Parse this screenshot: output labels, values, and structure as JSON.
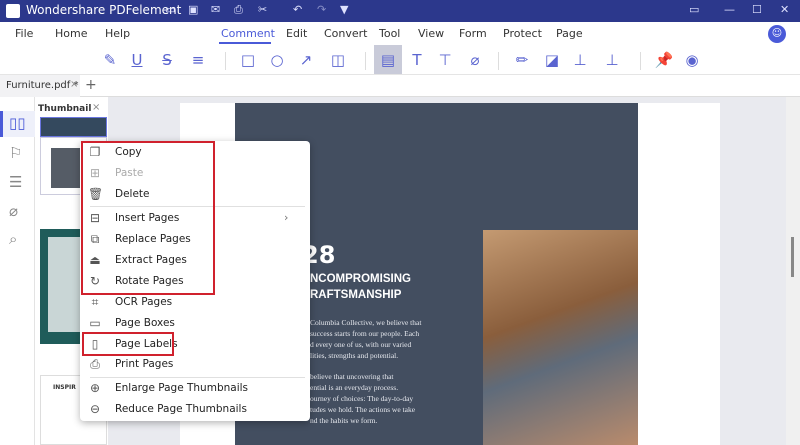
{
  "app": {
    "title": "Wondershare PDFelement",
    "colors": {
      "titlebar": "#2c388c",
      "accent": "#4a5ad8",
      "highlight_box": "#d0212d"
    }
  },
  "titlebar_icons": [
    "open-folder-icon",
    "save-icon",
    "mail-icon",
    "print-icon",
    "scissors-icon",
    "undo-icon",
    "redo-icon",
    "dropdown-arrow-icon"
  ],
  "menu": [
    "File",
    "Home",
    "Help",
    "Comment",
    "Edit",
    "Convert",
    "Tool",
    "View",
    "Form",
    "Protect",
    "Page"
  ],
  "active_menu": "Comment",
  "tab": {
    "label": "Furniture.pdf *",
    "close": "×",
    "add": "+"
  },
  "thumbnail_panel": {
    "title": "Thumbnail",
    "close": "×",
    "thumb_text": "INSPIR"
  },
  "context_menu": [
    {
      "label": "Copy",
      "icon": "copy-icon"
    },
    {
      "label": "Paste",
      "icon": "paste-icon",
      "disabled": true
    },
    {
      "label": "Delete",
      "icon": "trash-icon"
    },
    {
      "label": "Insert Pages",
      "icon": "insert-pages-icon",
      "submenu": "›"
    },
    {
      "label": "Replace Pages",
      "icon": "replace-pages-icon"
    },
    {
      "label": "Extract Pages",
      "icon": "extract-pages-icon"
    },
    {
      "label": "Rotate Pages",
      "icon": "rotate-icon"
    },
    {
      "label": "OCR Pages",
      "icon": "ocr-icon"
    },
    {
      "label": "Page Boxes",
      "icon": "page-boxes-icon"
    },
    {
      "label": "Page Labels",
      "icon": "page-labels-icon"
    },
    {
      "label": "Print Pages",
      "icon": "print-icon"
    },
    {
      "label": "Enlarge Page Thumbnails",
      "icon": "zoom-in-icon"
    },
    {
      "label": "Reduce Page Thumbnails",
      "icon": "zoom-out-icon"
    }
  ],
  "document": {
    "number": "28",
    "heading1": "NCOMPROMISING",
    "heading2": "RAFTSMANSHIP",
    "para1": [
      "Columbia Collective, we believe that",
      "success starts from our people. Each",
      "d every one of us, with our varied",
      "lities, strengths and potential."
    ],
    "para2": [
      "believe that uncovering that",
      "ential is an everyday process.",
      "ourney of choices: The day-to-day",
      "tudes we hold. The actions we take",
      "nd the habits we form."
    ]
  }
}
